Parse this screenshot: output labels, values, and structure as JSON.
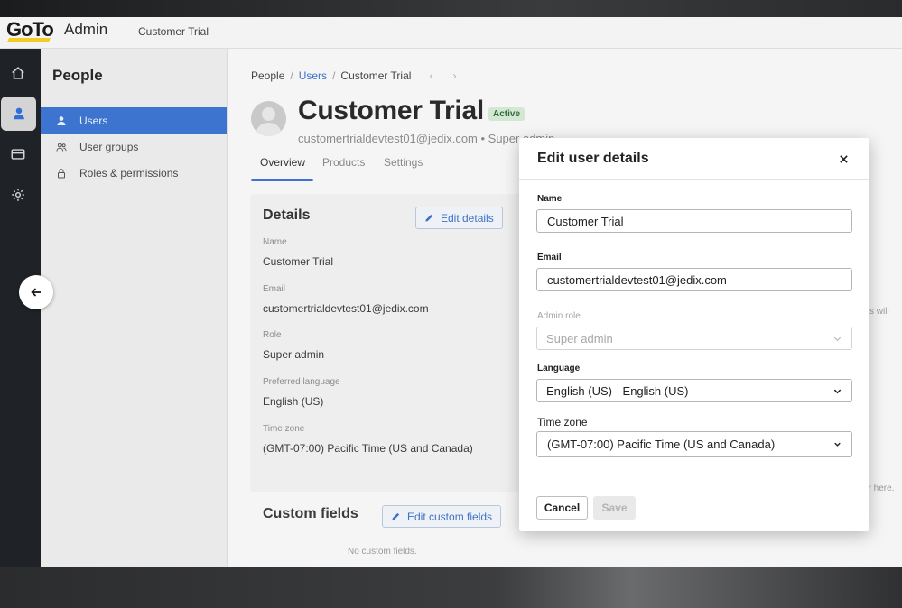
{
  "header": {
    "logo": "GoTo",
    "app_name": "Admin",
    "account": "Customer Trial"
  },
  "rail": {
    "items": [
      "home-icon",
      "person-icon",
      "billing-card-icon",
      "gear-icon"
    ],
    "active": "person-icon"
  },
  "sidebar": {
    "title": "People",
    "items": [
      {
        "label": "Users",
        "icon": "person-icon",
        "active": true
      },
      {
        "label": "User groups",
        "icon": "user-group-icon",
        "active": false
      },
      {
        "label": "Roles & permissions",
        "icon": "lock-icon",
        "active": false
      }
    ]
  },
  "breadcrumb": {
    "root": "People",
    "section": "Users",
    "current": "Customer Trial",
    "separator": "/"
  },
  "user": {
    "name": "Customer Trial",
    "status": "Active",
    "subtitle": "customertrialdevtest01@jedix.com • Super admin"
  },
  "tabs": [
    {
      "label": "Overview",
      "active": true
    },
    {
      "label": "Products",
      "active": false
    },
    {
      "label": "Settings",
      "active": false
    }
  ],
  "details": {
    "title": "Details",
    "edit_label": "Edit details",
    "fields": [
      {
        "label": "Name",
        "value": "Customer Trial"
      },
      {
        "label": "Email",
        "value": "customertrialdevtest01@jedix.com"
      },
      {
        "label": "Role",
        "value": "Super admin"
      },
      {
        "label": "Preferred language",
        "value": "English (US)"
      },
      {
        "label": "Time zone",
        "value": "(GMT-07:00) Pacific Time (US and Canada)"
      }
    ]
  },
  "custom_fields": {
    "title": "Custom fields",
    "edit_label": "Edit custom fields",
    "empty_text": "No custom fields."
  },
  "edge_texts": {
    "right_top": "s will",
    "right_bottom": "ar here."
  },
  "modal": {
    "title": "Edit user details",
    "name_label": "Name",
    "name_value": "Customer Trial",
    "email_label": "Email",
    "email_value": "customertrialdevtest01@jedix.com",
    "role_label": "Admin role",
    "role_value": "Super admin",
    "language_label": "Language",
    "language_value": "English (US) - English (US)",
    "timezone_label": "Time zone",
    "timezone_value": "(GMT-07:00) Pacific Time (US and Canada)",
    "cancel_label": "Cancel",
    "save_label": "Save"
  },
  "colors": {
    "accent": "#3c74cf",
    "rail": "#1f2328",
    "status_bg": "#d4e7d3",
    "status_text": "#2e6b36"
  }
}
